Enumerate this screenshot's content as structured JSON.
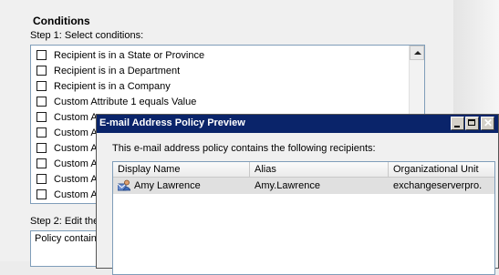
{
  "wizard": {
    "section_title": "Conditions",
    "step1_label": "Step 1: Select conditions:",
    "conditions": [
      "Recipient is in a State or Province",
      "Recipient is in a Department",
      "Recipient is in a Company",
      "Custom Attribute 1 equals Value",
      "Custom A",
      "Custom A",
      "Custom A",
      "Custom A",
      "Custom A",
      "Custom A"
    ],
    "step2_label": "Step 2: Edit the",
    "policy_text": "Policy contain"
  },
  "dialog": {
    "title": "E-mail Address Policy Preview",
    "description": "This e-mail address policy contains the following recipients:",
    "columns": [
      "Display Name",
      "Alias",
      "Organizational Unit"
    ],
    "rows": [
      {
        "icon": "user-mailbox-icon",
        "display_name": "Amy Lawrence",
        "alias": "Amy.Lawrence",
        "ou": "exchangeserverpro."
      }
    ]
  },
  "colors": {
    "titlebar": "#0a246a",
    "selected_row": "#e0e0e0",
    "list_border": "#7f9db9"
  }
}
